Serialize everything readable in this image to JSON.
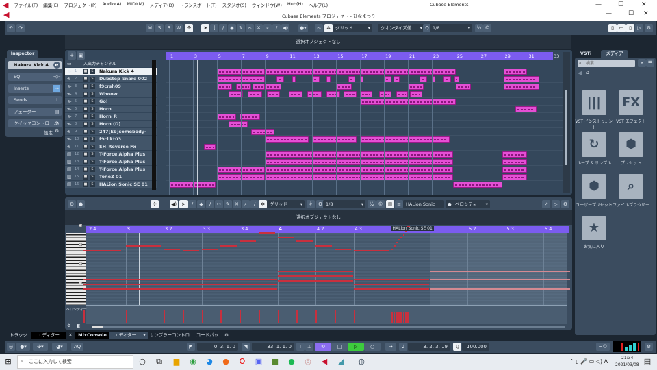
{
  "menu": {
    "items": [
      "ファイル(F)",
      "編集(E)",
      "プロジェクト(P)",
      "Audio(A)",
      "MIDI(M)",
      "メディア(D)",
      "トランスポート(T)",
      "スタジオ(S)",
      "ウィンドウ(W)",
      "Hub(H)",
      "ヘルプ(L)"
    ],
    "app_name": "Cubase Elements"
  },
  "window": {
    "title": "Cubase Elements プロジェクト - ひなまつり"
  },
  "toolbar": {
    "msrw": [
      "M",
      "S",
      "R",
      "W"
    ],
    "snap_type": "グリッド",
    "quantize_type": "クオンタイズ値",
    "quantize_value": "1/8",
    "q": "Q"
  },
  "info": {
    "no_selection": "選択オブジェクトなし"
  },
  "inspector": {
    "tab": "Inspector",
    "track_name": "Nakura Kick 4",
    "sections": [
      "EQ",
      "Inserts",
      "Sends",
      "フェーダー",
      "クイックコントロール"
    ],
    "settings": "設定"
  },
  "arrange": {
    "io_channel": "入出力チャンネル",
    "bar_labels": [
      "1",
      "3",
      "5",
      "7",
      "9",
      "11",
      "13",
      "15",
      "17",
      "19",
      "21",
      "23",
      "25",
      "27",
      "29",
      "31",
      "33"
    ],
    "playhead_bar": 3.35,
    "tracks": [
      {
        "num": "1",
        "name": "Nakura Kick 4",
        "type": "audio",
        "clips": [
          [
            5,
            9
          ],
          [
            9,
            25
          ],
          [
            29,
            31
          ]
        ]
      },
      {
        "num": "2",
        "name": "Dubstep Snare 002",
        "type": "audio",
        "clips": [
          [
            5,
            9
          ],
          [
            10,
            10.6
          ],
          [
            11.3,
            11.6
          ],
          [
            13,
            13.6
          ],
          [
            14.2,
            14.5
          ],
          [
            16,
            16.6
          ],
          [
            17,
            17.3
          ],
          [
            19,
            19.6
          ],
          [
            19.8,
            20.3
          ],
          [
            22,
            22.6
          ],
          [
            23,
            23.3
          ],
          [
            24,
            24.6
          ],
          [
            24.9,
            25.3
          ],
          [
            29,
            32
          ]
        ]
      },
      {
        "num": "3",
        "name": "f9crsh09",
        "type": "audio",
        "clips": [
          [
            5,
            6.3
          ],
          [
            6.6,
            7.9
          ],
          [
            8,
            9
          ],
          [
            9,
            10.4
          ],
          [
            15,
            16.3
          ],
          [
            21,
            22.3
          ],
          [
            25,
            26.3
          ],
          [
            29,
            32
          ]
        ]
      },
      {
        "num": "4",
        "name": "Whoow",
        "type": "audio",
        "clips": [
          [
            6,
            7.2
          ],
          [
            7.6,
            8.8
          ],
          [
            9.2,
            10.3
          ],
          [
            11,
            12.2
          ],
          [
            12.6,
            13.8
          ],
          [
            14.2,
            15.3
          ],
          [
            15.6,
            16.7
          ],
          [
            17,
            18
          ],
          [
            18.6,
            19.6
          ],
          [
            20,
            21
          ],
          [
            21.2,
            22.2
          ]
        ]
      },
      {
        "num": "5",
        "name": "Go!",
        "type": "audio",
        "clips": [
          [
            17,
            25
          ]
        ]
      },
      {
        "num": "6",
        "name": "Horn",
        "type": "audio",
        "clips": [
          [
            30,
            31.8
          ]
        ]
      },
      {
        "num": "7",
        "name": "Horn_R",
        "type": "audio",
        "clips": [
          [
            5,
            6.6
          ],
          [
            6.9,
            8.6
          ]
        ]
      },
      {
        "num": "8",
        "name": "Horn (D)",
        "type": "audio",
        "clips": [
          [
            6,
            7.6
          ]
        ]
      },
      {
        "num": "9",
        "name": "247[kb]somebody-sc....if",
        "type": "audio",
        "clips": [
          [
            7.9,
            9.8
          ]
        ]
      },
      {
        "num": "10",
        "name": "f9cllkt03",
        "type": "audio",
        "clips": [
          [
            9,
            12.7
          ],
          [
            13,
            16.7
          ],
          [
            17,
            24.5
          ]
        ]
      },
      {
        "num": "11",
        "name": "SH_Reverse Fx",
        "type": "audio",
        "clips": [
          [
            3.9,
            4.9
          ]
        ]
      },
      {
        "num": "12",
        "name": "T-Force Alpha Plus ...01",
        "type": "instrument",
        "clips": [
          [
            9,
            24.8
          ],
          [
            28.9,
            31
          ]
        ]
      },
      {
        "num": "13",
        "name": "T-Force Alpha Plus ...D)",
        "type": "instrument",
        "clips": [
          [
            9,
            24.8
          ],
          [
            28.9,
            31
          ]
        ]
      },
      {
        "num": "14",
        "name": "T-Force Alpha Plus ...01",
        "type": "instrument",
        "clips": [
          [
            5,
            9
          ],
          [
            9,
            24.8
          ],
          [
            28.9,
            31
          ]
        ]
      },
      {
        "num": "15",
        "name": "ToneZ 01",
        "type": "instrument",
        "clips": [
          [
            5,
            9
          ],
          [
            9,
            24.8
          ],
          [
            28.9,
            31
          ]
        ]
      },
      {
        "num": "16",
        "name": "HALion Sonic SE 01",
        "type": "instrument",
        "clips": [
          [
            1,
            4.9
          ],
          [
            24.8,
            28.9
          ]
        ]
      }
    ]
  },
  "editor": {
    "snap_type": "グリッド",
    "quantize_value": "1/8",
    "instrument": "HALion Sonic SE.",
    "lane": "ベロシティー",
    "no_selection": "選択オブジェクトなし",
    "part_label": "HALion Sonic SE 01",
    "ruler": [
      {
        "label": "2.4",
        "beat": 7
      },
      {
        "label": "3",
        "beat": 8
      },
      {
        "label": "3.2",
        "beat": 9
      },
      {
        "label": "3.3",
        "beat": 10
      },
      {
        "label": "3.4",
        "beat": 11
      },
      {
        "label": "4",
        "beat": 12
      },
      {
        "label": "4.2",
        "beat": 13
      },
      {
        "label": "4.3",
        "beat": 14
      },
      {
        "label": "5",
        "beat": 16
      },
      {
        "label": "5.2",
        "beat": 17
      },
      {
        "label": "5.3",
        "beat": 18
      },
      {
        "label": "5.4",
        "beat": 19
      }
    ],
    "key_labels": [
      "C5",
      "C4",
      "C3",
      "C2"
    ],
    "velocity_label": "ベロシティー",
    "part_end_beat": 16,
    "notes": [
      [
        6.9,
        7.9,
        57
      ],
      [
        8,
        8.95,
        60
      ],
      [
        9,
        9.45,
        58
      ],
      [
        9.5,
        9.95,
        57
      ],
      [
        10,
        10.45,
        58
      ],
      [
        10.5,
        10.95,
        60
      ],
      [
        11,
        11.45,
        63
      ],
      [
        11.5,
        11.95,
        68
      ],
      [
        12,
        12.45,
        65
      ],
      [
        12.5,
        12.95,
        63
      ],
      [
        13,
        13.45,
        60
      ],
      [
        13.5,
        13.95,
        58
      ],
      [
        14,
        14.95,
        57
      ],
      [
        15,
        15.06,
        58
      ],
      [
        15.06,
        15.12,
        60
      ],
      [
        15.12,
        15.18,
        62
      ],
      [
        15.18,
        15.24,
        64
      ],
      [
        15.24,
        15.3,
        65
      ],
      [
        15.3,
        15.36,
        67
      ],
      [
        15.36,
        15.42,
        69
      ],
      [
        15.42,
        15.5,
        72
      ],
      [
        6.9,
        12,
        39
      ],
      [
        6.9,
        12,
        36
      ],
      [
        6.9,
        12,
        33
      ],
      [
        12,
        14,
        44
      ],
      [
        12,
        14,
        41
      ],
      [
        12,
        14,
        38
      ],
      [
        14,
        16,
        39
      ],
      [
        14,
        16,
        36
      ],
      [
        14,
        16,
        33
      ]
    ],
    "pale_notes": [
      [
        16,
        19.7,
        44
      ],
      [
        16,
        19.7,
        39
      ],
      [
        16,
        19.7,
        33
      ]
    ]
  },
  "right_panel": {
    "tabs": [
      "VSTi",
      "メディア"
    ],
    "search_placeholder": "検索",
    "tiles": [
      {
        "label": "VST インストゥ...ント",
        "glyph": "|||"
      },
      {
        "label": "VST エフェクト",
        "glyph": "FX"
      },
      {
        "label": "ループ & サンプル",
        "glyph": "↻"
      },
      {
        "label": "プリセット",
        "glyph": "⬢"
      },
      {
        "label": "ユーザープリセット",
        "glyph": "⬢"
      },
      {
        "label": "ファイルブラウザー",
        "glyph": "⌕"
      },
      {
        "label": "お気に入り",
        "glyph": "★"
      }
    ]
  },
  "bottom_tabs": [
    "トラック",
    "エディター",
    "MixConsole",
    "エディター",
    "サンプラーコントロール",
    "コードパッド"
  ],
  "transport": {
    "aq": "AQ",
    "left_locator": "0. 3. 1. 0",
    "right_locator": "33. 1. 1. 0",
    "position": "3. 2. 3. 19",
    "tempo": "100.000"
  },
  "taskbar": {
    "search_placeholder": "ここに入力して検索",
    "time": "21:34",
    "date": "2021/03/08"
  }
}
